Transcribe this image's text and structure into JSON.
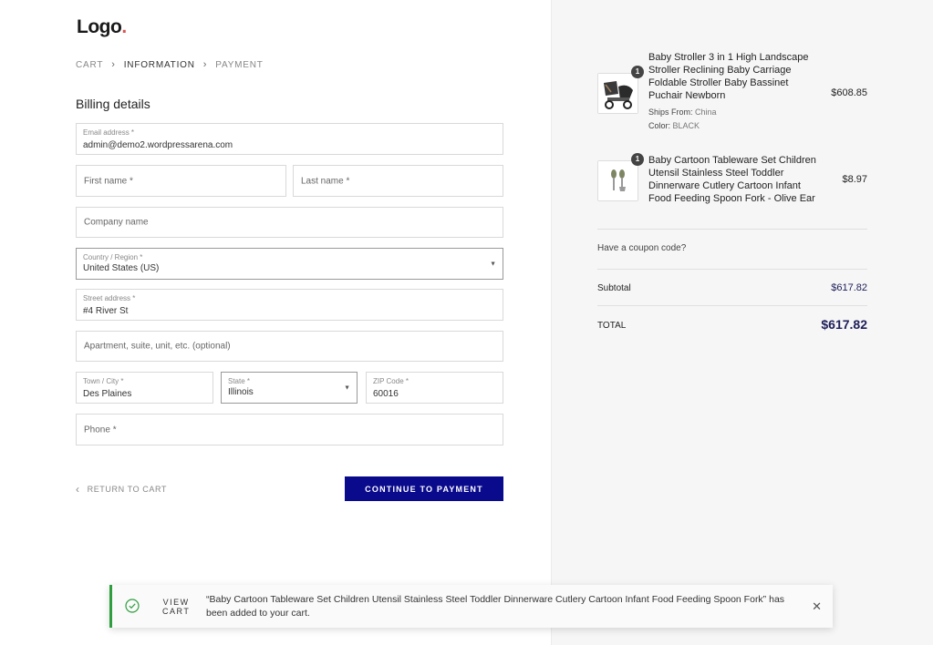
{
  "logo": {
    "text": "Logo",
    "dot": "."
  },
  "breadcrumb": {
    "cart": "CART",
    "information": "INFORMATION",
    "payment": "PAYMENT"
  },
  "billing": {
    "title": "Billing details",
    "email": {
      "label": "Email address",
      "value": "admin@demo2.wordpressarena.com"
    },
    "first_name": {
      "placeholder": "First name *"
    },
    "last_name": {
      "placeholder": "Last name *"
    },
    "company": {
      "placeholder": "Company name"
    },
    "country": {
      "label": "Country / Region",
      "value": "United States (US)"
    },
    "street": {
      "label": "Street address",
      "value": "#4 River St"
    },
    "apartment": {
      "placeholder": "Apartment, suite, unit, etc. (optional)"
    },
    "city": {
      "label": "Town / City",
      "value": "Des Plaines"
    },
    "state": {
      "label": "State",
      "value": "Illinois"
    },
    "zip": {
      "label": "ZIP Code",
      "value": "60016"
    },
    "phone": {
      "placeholder": "Phone *"
    },
    "required_mark": "*"
  },
  "actions": {
    "return": "RETURN TO CART",
    "continue": "CONTINUE TO PAYMENT"
  },
  "order": {
    "items": [
      {
        "qty": "1",
        "name": "Baby Stroller 3 in 1 High Landscape Stroller Reclining Baby Carriage Foldable Stroller Baby Bassinet Puchair Newborn",
        "ships_label": "Ships From:",
        "ships_value": "China",
        "color_label": "Color:",
        "color_value": "BLACK",
        "price": "$608.85",
        "thumb_icon": "stroller-image"
      },
      {
        "qty": "1",
        "name": "Baby Cartoon Tableware Set Children Utensil Stainless Steel Toddler Dinnerware Cutlery Cartoon Infant Food Feeding Spoon Fork - Olive Ear",
        "price": "$8.97",
        "thumb_icon": "utensils-image"
      }
    ],
    "coupon": "Have a coupon code?",
    "subtotal_label": "Subtotal",
    "subtotal": "$617.82",
    "total_label": "TOTAL",
    "total": "$617.82"
  },
  "toast": {
    "view_line1": "VIEW",
    "view_line2": "CART",
    "message": "“Baby Cartoon Tableware Set Children Utensil Stainless Steel Toddler Dinnerware Cutlery Cartoon Infant Food Feeding Spoon Fork” has been added to your cart.",
    "close": "✕"
  },
  "colors": {
    "accent": "#0a0a8c",
    "success": "#2e9e3f",
    "price": "#1d1d5a"
  }
}
